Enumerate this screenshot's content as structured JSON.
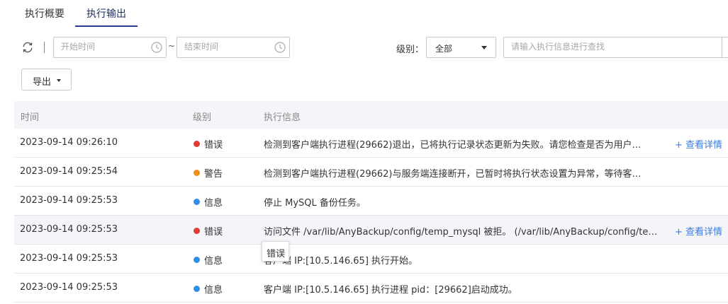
{
  "tabs": [
    {
      "label": "执行概要",
      "active": false
    },
    {
      "label": "执行输出",
      "active": true
    }
  ],
  "toolbar": {
    "start_placeholder": "开始时间",
    "end_placeholder": "结束时间",
    "range_separator": "~",
    "level_label": "级别：",
    "level_value": "全部",
    "search_placeholder": "请输入执行信息进行查找",
    "export_label": "导出"
  },
  "table": {
    "headers": [
      "时间",
      "级别",
      "执行信息"
    ],
    "rows": [
      {
        "time": "2023-09-14 09:26:10",
        "level": "错误",
        "level_color": "#e03c31",
        "message": "检测到客户端执行进程(29662)退出，已将执行记录状态更新为失败。请您检查是否为用户…",
        "detail": "+ 查看详情"
      },
      {
        "time": "2023-09-14 09:25:54",
        "level": "警告",
        "level_color": "#f08c1a",
        "message": "检测到客户端执行进程(29662)与服务端连接断开，已暂时将执行状态设置为异常，等待客…",
        "detail": ""
      },
      {
        "time": "2023-09-14 09:25:53",
        "level": "信息",
        "level_color": "#2f8ee8",
        "message": "停止 MySQL 备份任务。",
        "detail": ""
      },
      {
        "time": "2023-09-14 09:25:53",
        "level": "错误",
        "level_color": "#e03c31",
        "message": "访问文件 /var/lib/AnyBackup/config/temp_mysql 被拒。 (/var/lib/AnyBackup/config/te…",
        "detail": "+ 查看详情"
      },
      {
        "time": "2023-09-14 09:25:53",
        "level": "信息",
        "level_color": "#2f8ee8",
        "message": "客户端 IP:[10.5.146.65] 执行开始。",
        "detail": ""
      },
      {
        "time": "2023-09-14 09:25:53",
        "level": "信息",
        "level_color": "#2f8ee8",
        "message": "客户端 IP:[10.5.146.65] 执行进程 pid：[29662]启动成功。",
        "detail": ""
      }
    ]
  },
  "tooltip": {
    "text": "错误"
  },
  "colors": {
    "accent": "#2b3a8c",
    "link": "#3b7be6",
    "header_bg": "#f3f5f8"
  }
}
